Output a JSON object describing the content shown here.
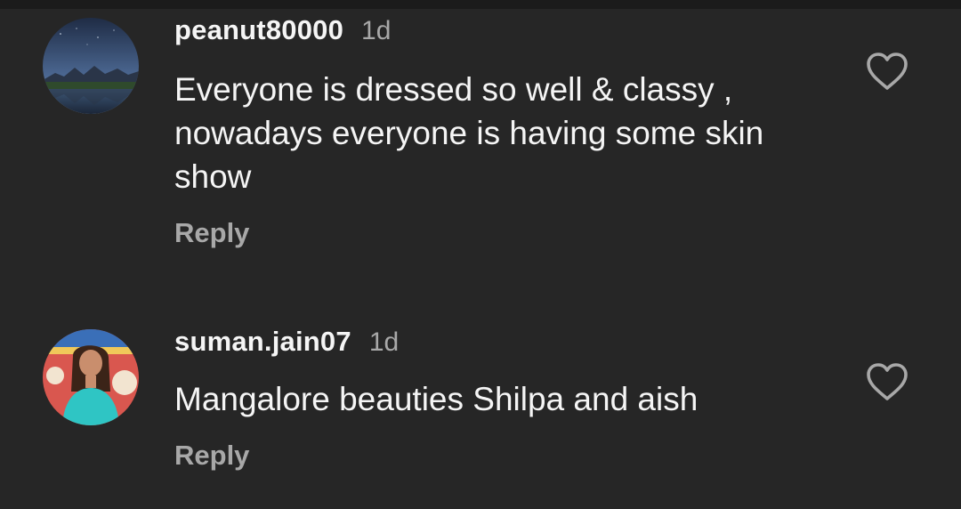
{
  "comments": [
    {
      "username": "peanut80000",
      "time": "1d",
      "text": "Everyone is dressed so well & classy , nowadays everyone is having some skin show",
      "reply_label": "Reply",
      "avatar_icon": "mountain-lake-avatar",
      "like_icon": "heart-outline-icon"
    },
    {
      "username": "suman.jain07",
      "time": "1d",
      "text": "Mangalore beauties Shilpa and aish",
      "reply_label": "Reply",
      "avatar_icon": "woman-portrait-avatar",
      "like_icon": "heart-outline-icon"
    }
  ],
  "colors": {
    "background": "#262626",
    "primary_text": "#f5f5f5",
    "secondary_text": "#a8a8a8",
    "divider": "#1b1b1b"
  }
}
